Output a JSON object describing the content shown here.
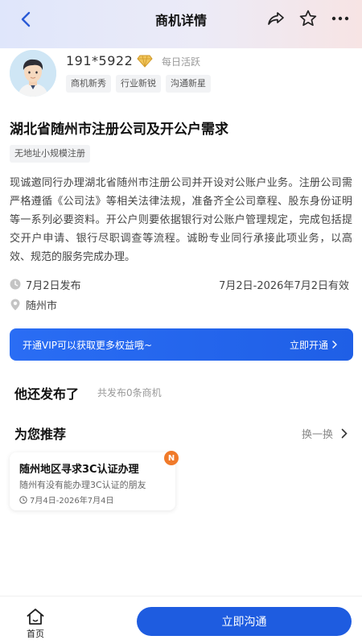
{
  "nav": {
    "title": "商机详情",
    "icons": [
      "back-icon",
      "share-icon",
      "star-icon",
      "more-icon"
    ]
  },
  "user": {
    "phone": "191*5922",
    "active_label": "每日活跃",
    "tags": [
      "商机新秀",
      "行业新锐",
      "沟通新星"
    ]
  },
  "post": {
    "title": "湖北省随州市注册公司及开公户需求",
    "tag": "无地址小规模注册",
    "description": "现诚邀同行办理湖北省随州市注册公司并开设对公账户业务。注册公司需严格遵循《公司法》等相关法律法规，准备齐全公司章程、股东身份证明等一系列必要资料。开公户则要依据银行对公账户管理规定，完成包括提交开户申请、银行尽职调查等流程。诚盼专业同行承接此项业务，以高效、规范的服务完成办理。",
    "publish_date": "7月2日发布",
    "valid_range": "7月2日-2026年7月2日有效",
    "location": "随州市"
  },
  "vip_banner": {
    "text": "开通VIP可以获取更多权益哦~",
    "action": "立即开通"
  },
  "others": {
    "title": "他还发布了",
    "count_text": "共发布0条商机"
  },
  "recommend": {
    "title": "为您推荐",
    "swap_label": "换一换",
    "cards": [
      {
        "title": "随州地区寻求3C认证办理",
        "desc": "随州有没有能办理3C认证的朋友",
        "date": "7月4日-2026年7月4日",
        "badge": "N"
      }
    ]
  },
  "bottom": {
    "home_label": "首页",
    "contact_label": "立即沟通"
  },
  "colors": {
    "accent": "#1e5ce0",
    "badge": "#f07a2a",
    "gold": "#e0a23a"
  }
}
